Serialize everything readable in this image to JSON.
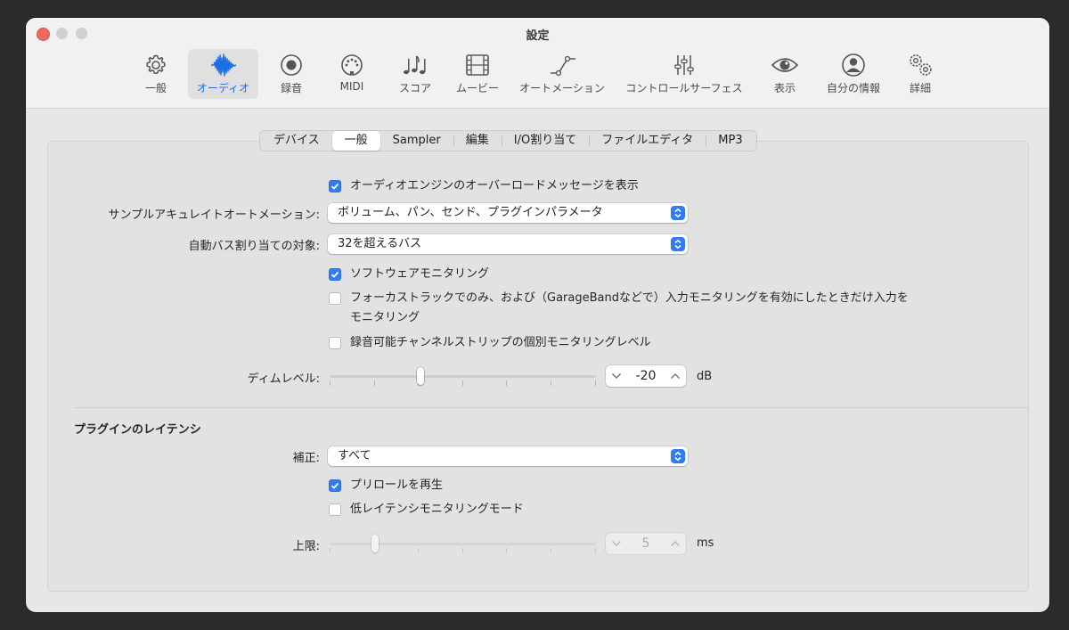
{
  "window": {
    "title": "設定"
  },
  "toolbar": {
    "items": [
      {
        "label": "一般",
        "icon": "gear-icon"
      },
      {
        "label": "オーディオ",
        "icon": "waveform-icon",
        "active": true
      },
      {
        "label": "録音",
        "icon": "record-icon"
      },
      {
        "label": "MIDI",
        "icon": "midi-connector-icon"
      },
      {
        "label": "スコア",
        "icon": "music-notes-icon"
      },
      {
        "label": "ムービー",
        "icon": "film-icon"
      },
      {
        "label": "オートメーション",
        "icon": "automation-curve-icon"
      },
      {
        "label": "コントロールサーフェス",
        "icon": "sliders-icon"
      },
      {
        "label": "表示",
        "icon": "eye-icon"
      },
      {
        "label": "自分の情報",
        "icon": "person-icon"
      },
      {
        "label": "詳細",
        "icon": "gears-icon"
      }
    ]
  },
  "tabs": [
    "デバイス",
    "一般",
    "Sampler",
    "編集",
    "I/O割り当て",
    "ファイルエディタ",
    "MP3"
  ],
  "active_tab": "一般",
  "general": {
    "overload_message": {
      "label": "オーディオエンジンのオーバーロードメッセージを表示",
      "checked": true
    },
    "sample_accurate_automation": {
      "label": "サンプルアキュレイトオートメーション:",
      "value": "ボリューム、パン、センド、プラグインパラメータ"
    },
    "auto_bus_assign": {
      "label": "自動バス割り当ての対象:",
      "value": "32を超えるバス"
    },
    "software_monitoring": {
      "label": "ソフトウェアモニタリング",
      "checked": true
    },
    "focused_track_monitoring": {
      "label_line1": "フォーカストラックでのみ、および（GarageBandなどで）入力モニタリングを有効にしたときだけ入力を",
      "label_line2": "モニタリング",
      "checked": false
    },
    "independent_monitoring_level": {
      "label": "録音可能チャンネルストリップの個別モニタリングレベル",
      "checked": false
    },
    "dim_level": {
      "label": "ディムレベル:",
      "value": "-20",
      "unit": "dB",
      "slider_fraction": 0.34
    }
  },
  "plugin_latency": {
    "title": "プラグインのレイテンシ",
    "compensation": {
      "label": "補正:",
      "value": "すべて"
    },
    "preroll": {
      "label": "プリロールを再生",
      "checked": true
    },
    "low_latency_mode": {
      "label": "低レイテンシモニタリングモード",
      "checked": false
    },
    "limit": {
      "label": "上限:",
      "value": "5",
      "unit": "ms",
      "slider_fraction": 0.17,
      "enabled": false
    }
  },
  "colors": {
    "accent": "#2f7cf6",
    "active_label": "#1b6fe4",
    "close_button": "#ec6a5e"
  }
}
